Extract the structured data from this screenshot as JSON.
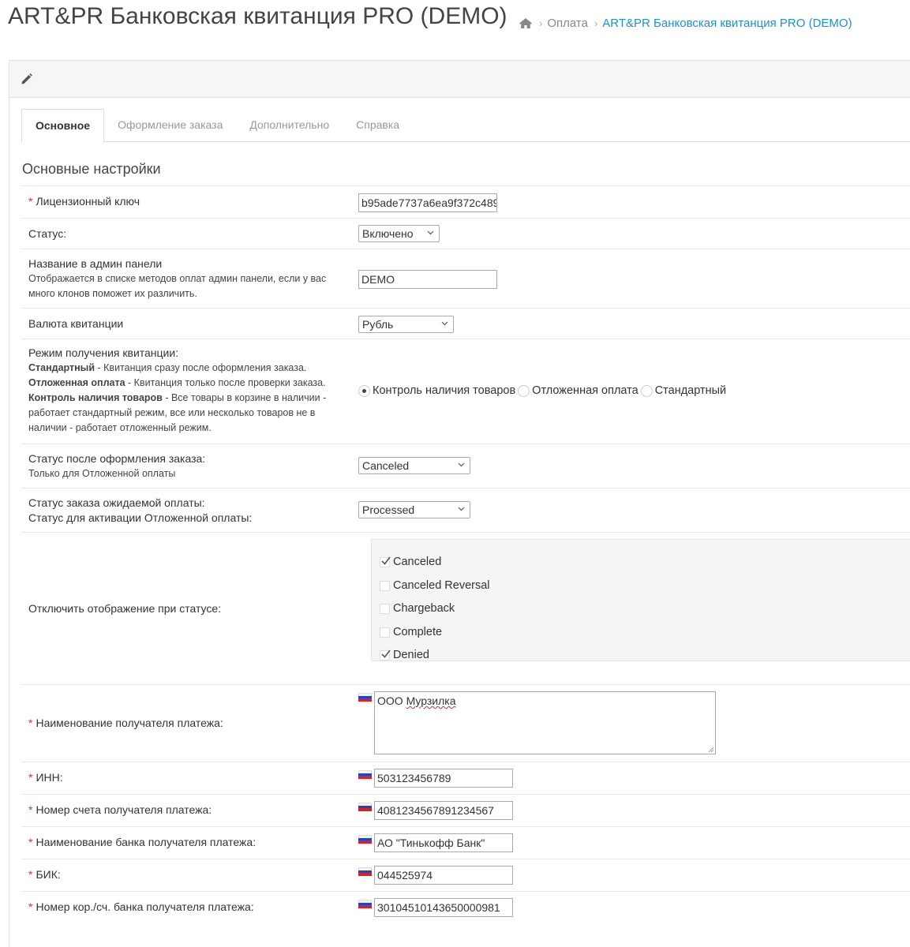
{
  "header": {
    "title": "ART&PR Банковская квитанция PRO (DEMO)",
    "breadcrumb": [
      {
        "label": "Оплата"
      },
      {
        "label": "ART&PR Банковская квитанция PRO (DEMO)"
      }
    ]
  },
  "tabs": [
    {
      "label": "Основное",
      "active": true
    },
    {
      "label": "Оформление заказа"
    },
    {
      "label": "Дополнительно"
    },
    {
      "label": "Справка"
    }
  ],
  "section_title": "Основные настройки",
  "fields": {
    "license": {
      "label": "Лицензионный ключ",
      "value": "b95ade7737a6ea9f372c489"
    },
    "status": {
      "label": "Статус:",
      "value": "Включено"
    },
    "admin_name": {
      "label": "Название в админ панели",
      "hint": "Отображается в списке методов оплат админ панели, если у вас много клонов поможет их различить.",
      "value": "DEMO"
    },
    "currency": {
      "label": "Валюта квитанции",
      "value": "Рубль"
    },
    "mode": {
      "label": "Режим получения квитанции:",
      "std_name": "Стандартный",
      "std_desc": " - Квитанция сразу после оформления заказа.",
      "delay_name": "Отложенная оплата",
      "delay_desc": " - Квитанция только после проверки заказа.",
      "control_name": "Контроль наличия товаров",
      "control_desc": " - Все товары в корзине в наличии - работает стандартный режим, все или несколько товаров не в наличии - работает отложенный режим.",
      "options": [
        "Контроль наличия товаров",
        "Отложенная оплата",
        "Стандартный"
      ],
      "selected": "Контроль наличия товаров"
    },
    "after_order_status": {
      "label": "Статус после оформления заказа:",
      "hint": "Только для Отложенной оплаты",
      "value": "Canceled"
    },
    "awaiting_status": {
      "label": "Статус заказа ожидаемой оплаты:",
      "label2": "Статус для активации Отложенной оплаты:",
      "value": "Processed"
    },
    "disable_display": {
      "label": "Отключить отображение при статусе:",
      "options": [
        {
          "label": "Canceled",
          "checked": true
        },
        {
          "label": "Canceled Reversal",
          "checked": false
        },
        {
          "label": "Chargeback",
          "checked": false
        },
        {
          "label": "Complete",
          "checked": false
        },
        {
          "label": "Denied",
          "checked": true
        }
      ]
    },
    "recipient_name": {
      "label": "Наименование получателя платежа:",
      "value_prefix": "ООО ",
      "value_word": "Мурзилка"
    },
    "inn": {
      "label": "ИНН:",
      "value": "503123456789"
    },
    "account": {
      "label": "Номер счета получателя платежа:",
      "value": "4081234567891234567"
    },
    "bank_name": {
      "label": "Наименование банка получателя платежа:",
      "value": "АО \"Тинькофф Банк\""
    },
    "bik": {
      "label": "БИК:",
      "value": "044525974"
    },
    "corr_account": {
      "label": "Номер кор./сч. банка получателя платежа:",
      "value": "30104510143650000981"
    }
  },
  "colors": {
    "accent": "#1e91cf",
    "required": "#e0282f"
  },
  "icons": {
    "home": "home-icon",
    "edit": "pencil-icon",
    "flag": "flag-ru-icon"
  }
}
